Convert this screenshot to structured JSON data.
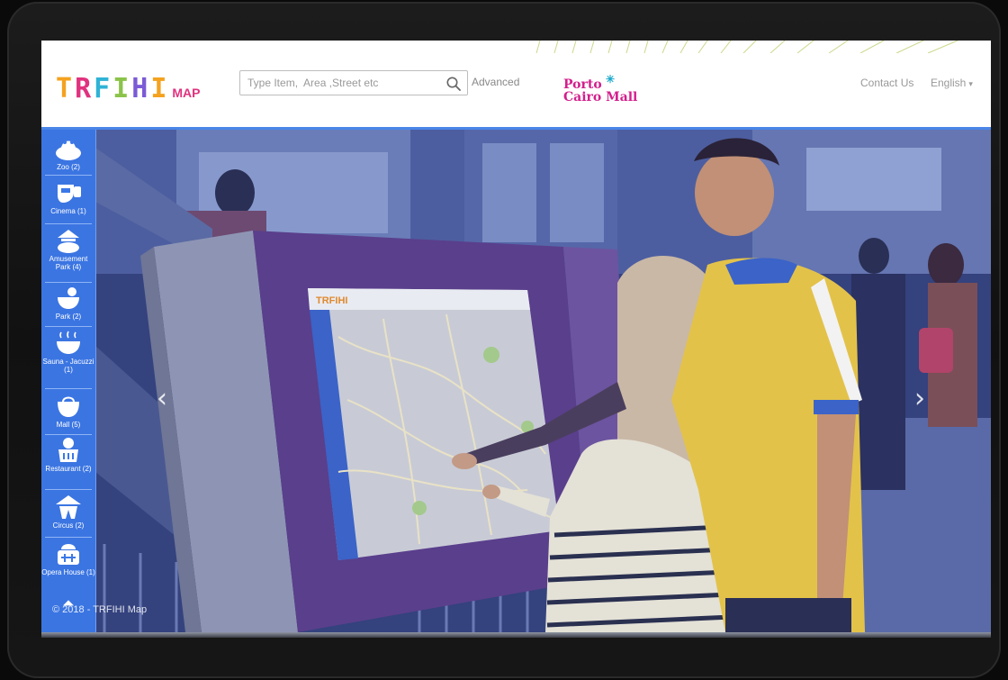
{
  "header": {
    "logo_text": "TRFIHI",
    "logo_suffix": "MAP",
    "logo_colors": [
      "#f4a21f",
      "#e0327e",
      "#2fb2d6",
      "#8bc34a",
      "#7b5bd6",
      "#f4a21f"
    ],
    "search": {
      "placeholder": "Type Item,  Area ,Street etc",
      "value": ""
    },
    "advanced_label": "Advanced",
    "partner_line1": "Porto",
    "partner_line2": "Cairo Mall",
    "contact_label": "Contact Us",
    "language_label": "English"
  },
  "sidebar": {
    "accent": "#3b78e8",
    "items": [
      {
        "label": "Zoo (2)",
        "icon": "zoo-icon"
      },
      {
        "label": "Cinema (1)",
        "icon": "cinema-icon"
      },
      {
        "label": "Amusement Park (4)",
        "icon": "amusement-park-icon"
      },
      {
        "label": "Park (2)",
        "icon": "park-icon"
      },
      {
        "label": "Sauna - Jacuzzi (1)",
        "icon": "sauna-icon"
      },
      {
        "label": "Mall (5)",
        "icon": "mall-icon"
      },
      {
        "label": "Restaurant (2)",
        "icon": "restaurant-icon"
      },
      {
        "label": "Circus (2)",
        "icon": "circus-icon"
      },
      {
        "label": "Opera House (1)",
        "icon": "opera-house-icon"
      }
    ]
  },
  "carousel": {
    "prev_icon": "chevron-left-icon",
    "next_icon": "chevron-right-icon",
    "kiosk_logo": "TRFIHI"
  },
  "footer": {
    "copyright": "© 2018 - TRFIHI Map"
  }
}
